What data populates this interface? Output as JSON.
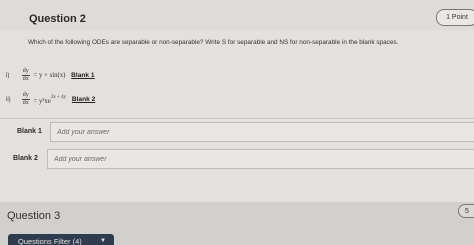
{
  "question": {
    "title": "Question 2",
    "points": "1 Point",
    "prompt": "Which of the following ODEs are separable or non-separable? Write S for separable and NS for non-separable in the blank spaces."
  },
  "odes": [
    {
      "number": "i)",
      "numerator": "dy",
      "denominator": "dx",
      "rhs": "= y + sin(x)",
      "blank": "Blank 1"
    },
    {
      "number": "ii)",
      "numerator": "dy",
      "denominator": "dx",
      "rhs_base": "= y²xe",
      "rhs_exp": "3x + 4y",
      "blank": "Blank 2"
    }
  ],
  "answers": [
    {
      "label": "Blank 1",
      "placeholder": "Add your answer"
    },
    {
      "label": "Blank 2",
      "placeholder": "Add your answer"
    }
  ],
  "next_question": {
    "title": "Question 3",
    "points": "5"
  },
  "filter": {
    "label": "Questions Filter (4)",
    "chevron": "▼"
  }
}
